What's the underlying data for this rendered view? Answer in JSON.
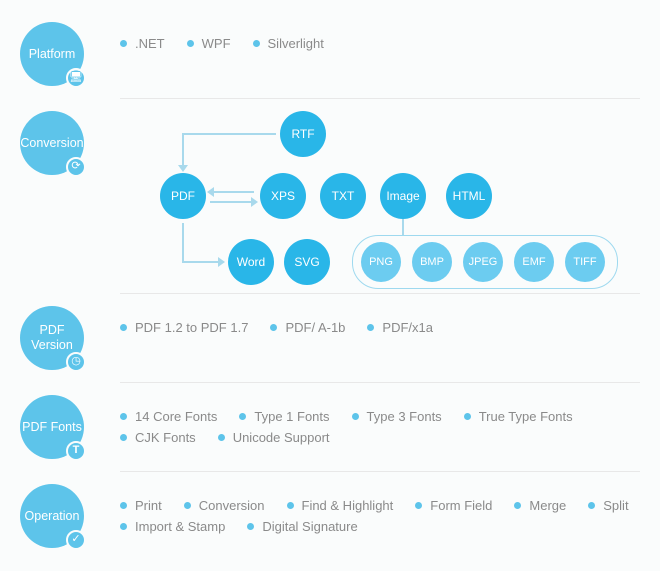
{
  "sections": {
    "platform": {
      "label": "Platform",
      "icon": "monitor-icon",
      "iconGlyph": "🖥"
    },
    "conversion": {
      "label": "Conversion",
      "icon": "refresh-icon",
      "iconGlyph": "⟳"
    },
    "version": {
      "label": "PDF Version",
      "icon": "clock-icon",
      "iconGlyph": "◷"
    },
    "fonts": {
      "label": "PDF Fonts",
      "icon": "text-icon",
      "iconGlyph": "T"
    },
    "operation": {
      "label": "Operation",
      "icon": "check-icon",
      "iconGlyph": "✓"
    }
  },
  "platform_tags": [
    ".NET",
    "WPF",
    "Silverlight"
  ],
  "version_tags": [
    "PDF 1.2 to PDF 1.7",
    "PDF/ A-1b",
    "PDF/x1a"
  ],
  "fonts_tags": [
    "14 Core Fonts",
    "Type 1 Fonts",
    "Type 3 Fonts",
    "True Type Fonts",
    "CJK Fonts",
    "Unicode Support"
  ],
  "operation_tags": [
    "Print",
    "Conversion",
    "Find & Highlight",
    "Form Field",
    "Merge",
    "Split",
    "Import & Stamp",
    "Digital Signature"
  ],
  "chart_data": {
    "type": "diagram",
    "title": "PDF Conversion Relationships",
    "nodes": [
      "PDF",
      "RTF",
      "XPS",
      "TXT",
      "Image",
      "HTML",
      "Word",
      "SVG",
      "PNG",
      "BMP",
      "JPEG",
      "EMF",
      "TIFF"
    ],
    "edges": [
      {
        "from": "RTF",
        "to": "PDF",
        "direction": "one-way"
      },
      {
        "from": "PDF",
        "to": "XPS",
        "direction": "two-way"
      },
      {
        "from": "PDF",
        "to": "TXT",
        "direction": "one-way"
      },
      {
        "from": "PDF",
        "to": "Image",
        "direction": "one-way"
      },
      {
        "from": "PDF",
        "to": "HTML",
        "direction": "one-way"
      },
      {
        "from": "PDF",
        "to": "Word",
        "direction": "one-way"
      },
      {
        "from": "PDF",
        "to": "SVG",
        "direction": "one-way"
      }
    ],
    "groups": [
      {
        "parent": "Image",
        "children": [
          "PNG",
          "BMP",
          "JPEG",
          "EMF",
          "TIFF"
        ]
      }
    ],
    "labels": {
      "PDF": "PDF",
      "RTF": "RTF",
      "XPS": "XPS",
      "TXT": "TXT",
      "Image": "Image",
      "HTML": "HTML",
      "Word": "Word",
      "SVG": "SVG",
      "PNG": "PNG",
      "BMP": "BMP",
      "JPEG": "JPEG",
      "EMF": "EMF",
      "TIFF": "TIFF"
    }
  }
}
